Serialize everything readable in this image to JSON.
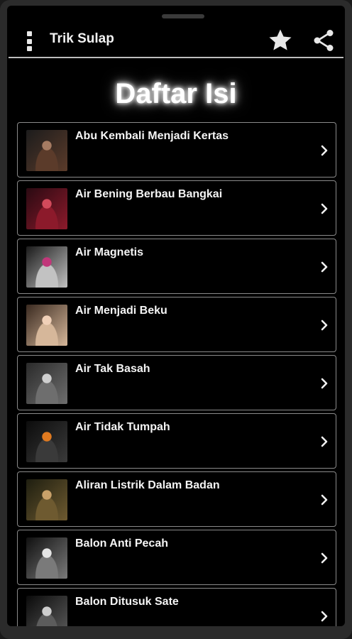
{
  "app": {
    "title": "Trik Sulap"
  },
  "toolbar": {
    "menu_icon": "more-vert-icon",
    "favorite_icon": "star-icon",
    "share_icon": "share-icon"
  },
  "page": {
    "heading": "Daftar Isi"
  },
  "list": {
    "items": [
      {
        "label": "Abu Kembali Menjadi Kertas",
        "thumb_colors": [
          "#1c1c1c",
          "#5b3b2a",
          "#a57b62"
        ]
      },
      {
        "label": "Air Bening Berbau Bangkai",
        "thumb_colors": [
          "#2a0a12",
          "#8c1a2b",
          "#d24a5b"
        ]
      },
      {
        "label": "Air Magnetis",
        "thumb_colors": [
          "#1a1a1a",
          "#c2c2c2",
          "#c1377a"
        ]
      },
      {
        "label": "Air Menjadi Beku",
        "thumb_colors": [
          "#3a2a20",
          "#d6b79a",
          "#f0d0b8"
        ]
      },
      {
        "label": "Air Tak Basah",
        "thumb_colors": [
          "#2a2a2a",
          "#6e6e6e",
          "#cfcfcf"
        ]
      },
      {
        "label": "Air Tidak Tumpah",
        "thumb_colors": [
          "#0c0c0c",
          "#3a3a3a",
          "#e07a20"
        ]
      },
      {
        "label": "Aliran Listrik Dalam Badan",
        "thumb_colors": [
          "#1e1e10",
          "#6e5a30",
          "#c9a16a"
        ]
      },
      {
        "label": "Balon Anti Pecah",
        "thumb_colors": [
          "#101010",
          "#7a7a7a",
          "#e5e5e5"
        ]
      },
      {
        "label": "Balon Ditusuk Sate",
        "thumb_colors": [
          "#0a0a0a",
          "#5c5c5c",
          "#cdcdcd"
        ]
      }
    ],
    "chevron_icon": "chevron-right-icon"
  }
}
